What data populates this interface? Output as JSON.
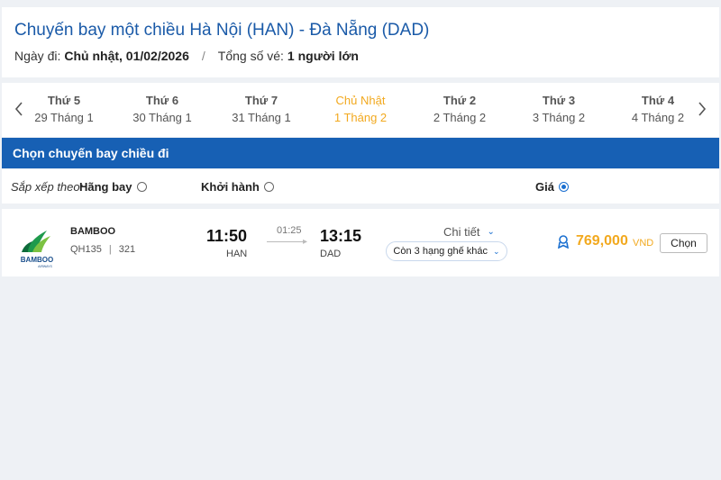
{
  "header": {
    "title": "Chuyến bay một chiều Hà Nội (HAN) - Đà Nẵng (DAD)",
    "date_label": "Ngày đi:",
    "date_value": "Chủ nhật, 01/02/2026",
    "separator": "/",
    "tickets_label": "Tổng số vé:",
    "tickets_value": "1 người lớn"
  },
  "datebar": {
    "prev_icon": "chevron-left-icon",
    "next_icon": "chevron-right-icon",
    "days": [
      {
        "name": "Thứ 5",
        "date": "29 Tháng 1"
      },
      {
        "name": "Thứ 6",
        "date": "30 Tháng 1"
      },
      {
        "name": "Thứ 7",
        "date": "31 Tháng 1"
      },
      {
        "name": "Chủ Nhật",
        "date": "1 Tháng 2"
      },
      {
        "name": "Thứ 2",
        "date": "2 Tháng 2"
      },
      {
        "name": "Thứ 3",
        "date": "3 Tháng 2"
      },
      {
        "name": "Thứ 4",
        "date": "4 Tháng 2"
      }
    ],
    "active_index": 3,
    "active_color": "#f2a91f"
  },
  "section_title": "Chọn chuyến bay chiều đi",
  "sort": {
    "label": "Sắp xếp theo:",
    "options": [
      {
        "label": "Hãng bay",
        "checked": false
      },
      {
        "label": "Khởi hành",
        "checked": false
      },
      {
        "label": "Giá",
        "checked": true
      }
    ]
  },
  "flight": {
    "airline": "BAMBOO",
    "logo_text": "BAMBOO",
    "logo_sub": "AIRWAYS",
    "flight_number": "QH135",
    "aircraft": "321",
    "depart_time": "11:50",
    "depart_airport": "HAN",
    "duration": "01:25",
    "arrive_time": "13:15",
    "arrive_airport": "DAD",
    "detail_label": "Chi tiết",
    "seat_classes": "Còn 3 hạng ghế khác",
    "price": "769,000",
    "currency": "VND",
    "choose_label": "Chọn"
  },
  "colors": {
    "brand_blue": "#1760b4",
    "title_blue": "#1a5aa8",
    "price_orange": "#f2a91f",
    "bamboo_green": "#1e9a4c"
  }
}
